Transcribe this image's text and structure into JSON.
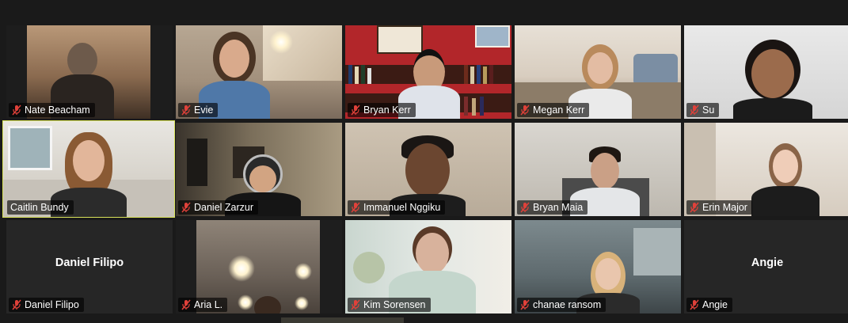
{
  "meeting": {
    "participants": [
      {
        "name": "Nate Beacham",
        "muted": true,
        "video": true
      },
      {
        "name": "Evie",
        "muted": true,
        "video": true
      },
      {
        "name": "Bryan Kerr",
        "muted": true,
        "video": true
      },
      {
        "name": "Megan Kerr",
        "muted": true,
        "video": true
      },
      {
        "name": "Su",
        "muted": true,
        "video": true
      },
      {
        "name": "Caitlin Bundy",
        "muted": false,
        "video": true,
        "active_speaker": true
      },
      {
        "name": "Daniel Zarzur",
        "muted": true,
        "video": true
      },
      {
        "name": "Immanuel Nggiku",
        "muted": true,
        "video": true
      },
      {
        "name": "Bryan Maia",
        "muted": true,
        "video": true
      },
      {
        "name": "Erin Major",
        "muted": true,
        "video": true
      },
      {
        "name": "Daniel Filipo",
        "muted": true,
        "video": false,
        "center_label": "Daniel Filipo"
      },
      {
        "name": "Aria L.",
        "muted": true,
        "video": true
      },
      {
        "name": "Kim Sorensen",
        "muted": true,
        "video": true
      },
      {
        "name": "chanae ransom",
        "muted": true,
        "video": true
      },
      {
        "name": "Angie",
        "muted": true,
        "video": false,
        "center_label": "Angie"
      }
    ]
  },
  "colors": {
    "background": "#1a1a1a",
    "tile_empty": "#262626",
    "active_speaker_border": "#d9e35a",
    "muted_icon": "#e0413a",
    "nameplate_text": "#ffffff"
  },
  "icons": {
    "muted": "microphone-muted-icon"
  }
}
